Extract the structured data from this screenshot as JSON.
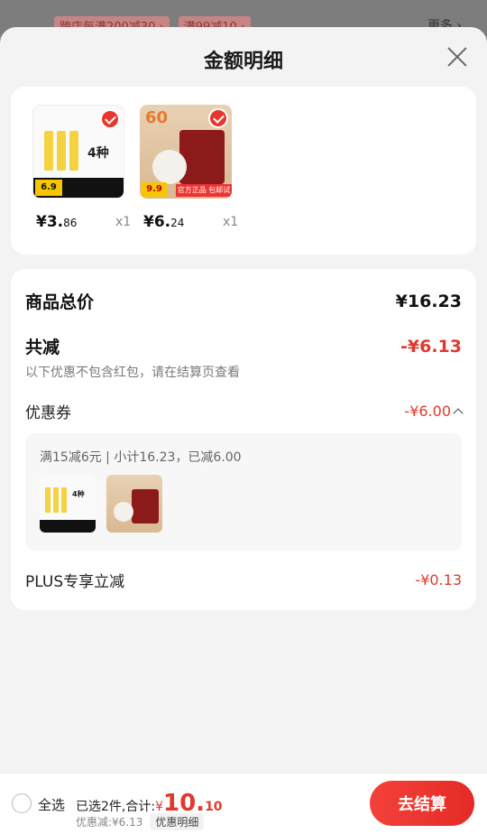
{
  "background": {
    "promos": [
      "跨店每满200减30 ›",
      "满99减10 ›"
    ],
    "more": "更多 ›"
  },
  "sheet": {
    "title": "金额明细"
  },
  "products": [
    {
      "price_int": "¥3.",
      "price_dec": "86",
      "qty": "x1"
    },
    {
      "price_int": "¥6.",
      "price_dec": "24",
      "qty": "x1"
    }
  ],
  "summary": {
    "total_label": "商品总价",
    "total_value": "¥16.23",
    "discount_label": "共减",
    "discount_value": "-¥6.13",
    "note": "以下优惠不包含红包，请在结算页查看",
    "coupon_label": "优惠券",
    "coupon_value": "-¥6.00",
    "coupon_detail": "满15减6元 | 小计16.23，已减6.00",
    "plus_label": "PLUS专享立减",
    "plus_value": "-¥0.13"
  },
  "bottom": {
    "select_all": "全选",
    "selected_text": "已选2件,合计:",
    "currency": "¥",
    "total_int": "10.",
    "total_dec": "10",
    "discount_text": "优惠减:¥6.13",
    "detail_link": "优惠明细",
    "checkout": "去结算"
  },
  "colors": {
    "accent": "#e0392e",
    "button": "#f3423a"
  }
}
